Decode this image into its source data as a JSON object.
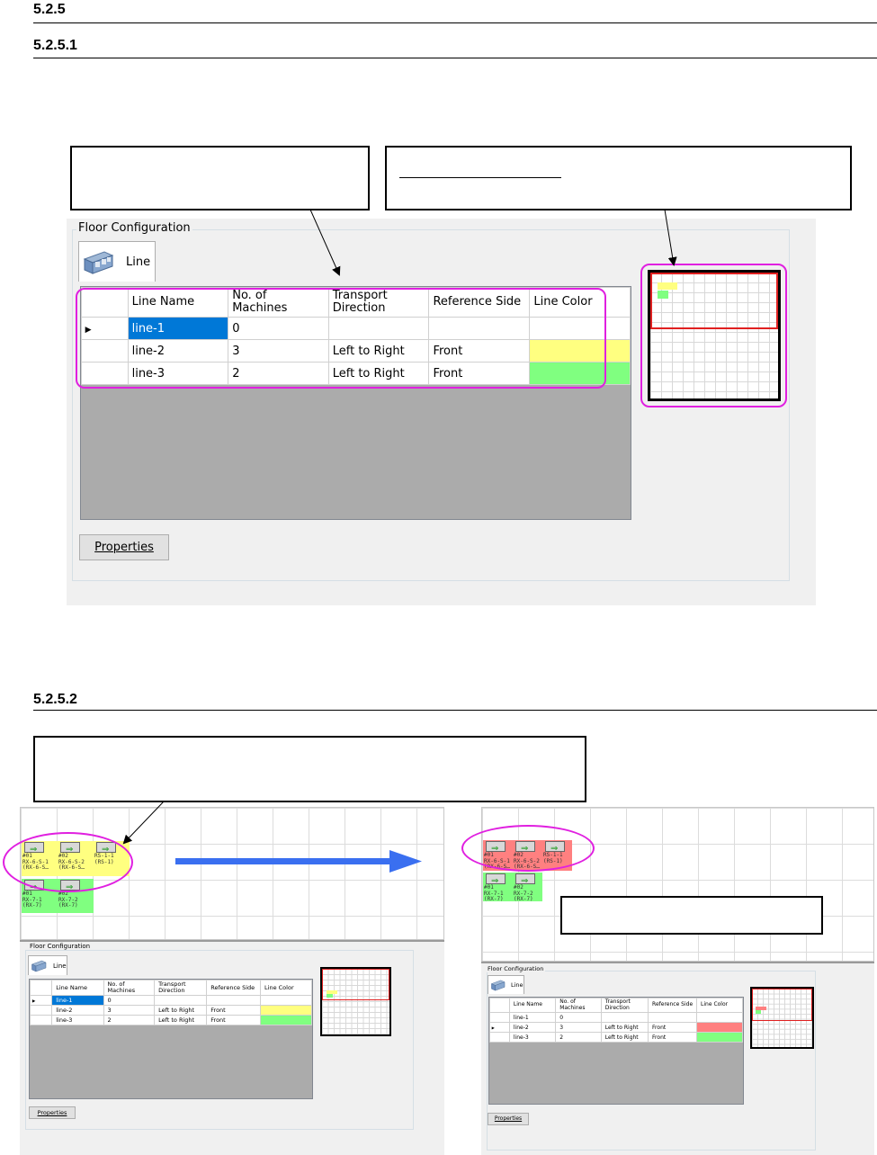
{
  "section": {
    "main_heading": "5.2.5",
    "sub1_heading": "5.2.5.1",
    "sub2_heading": "5.2.5.2"
  },
  "floor_config": {
    "group_label": "Floor Configuration",
    "tab_label": "Line",
    "columns": [
      "Line Name",
      "No. of Machines",
      "Transport Direction",
      "Reference Side",
      "Line Color"
    ],
    "column_lines": [
      [
        "Line Name"
      ],
      [
        "No. of",
        "Machines"
      ],
      [
        "Transport",
        "Direction"
      ],
      [
        "Reference Side"
      ],
      [
        "Line Color"
      ]
    ],
    "rows_before": [
      {
        "name": "line-1",
        "machines": "0",
        "direction": "",
        "side": "",
        "color": "#ffffff",
        "current": true,
        "selected": true
      },
      {
        "name": "line-2",
        "machines": "3",
        "direction": "Left to Right",
        "side": "Front",
        "color": "#ffff80",
        "current": false,
        "selected": false
      },
      {
        "name": "line-3",
        "machines": "2",
        "direction": "Left to Right",
        "side": "Front",
        "color": "#80ff80",
        "current": false,
        "selected": false
      }
    ],
    "rows_after": [
      {
        "name": "line-1",
        "machines": "0",
        "direction": "",
        "side": "",
        "color": "#ffffff",
        "current": false,
        "selected": false
      },
      {
        "name": "line-2",
        "machines": "3",
        "direction": "Left to Right",
        "side": "Front",
        "color": "#ff8080",
        "current": true,
        "selected": false
      },
      {
        "name": "line-3",
        "machines": "2",
        "direction": "Left to Right",
        "side": "Front",
        "color": "#80ff80",
        "current": false,
        "selected": false
      }
    ],
    "properties_label": "Properties",
    "row_indicator": "▶"
  },
  "floor_machines": {
    "line2": [
      {
        "label": "#01\nRX-6-S-1\n(RX-6-S…"
      },
      {
        "label": "#02\nRX-6-S-2\n(RX-6-S…"
      },
      {
        "label": "RS-1-1\n(RS-1)"
      }
    ],
    "line3": [
      {
        "label": "#01\nRX-7-1\n(RX-7)"
      },
      {
        "label": "#02\nRX-7-2\n(RX-7)"
      }
    ]
  },
  "colors": {
    "highlight": "#e020e0",
    "selection": "#0078d7",
    "line2_before": "#ffff80",
    "line2_after": "#ff8080",
    "line3": "#80ff80",
    "arrow": "#3a6ff0",
    "minimap_frame": "#e02020"
  }
}
